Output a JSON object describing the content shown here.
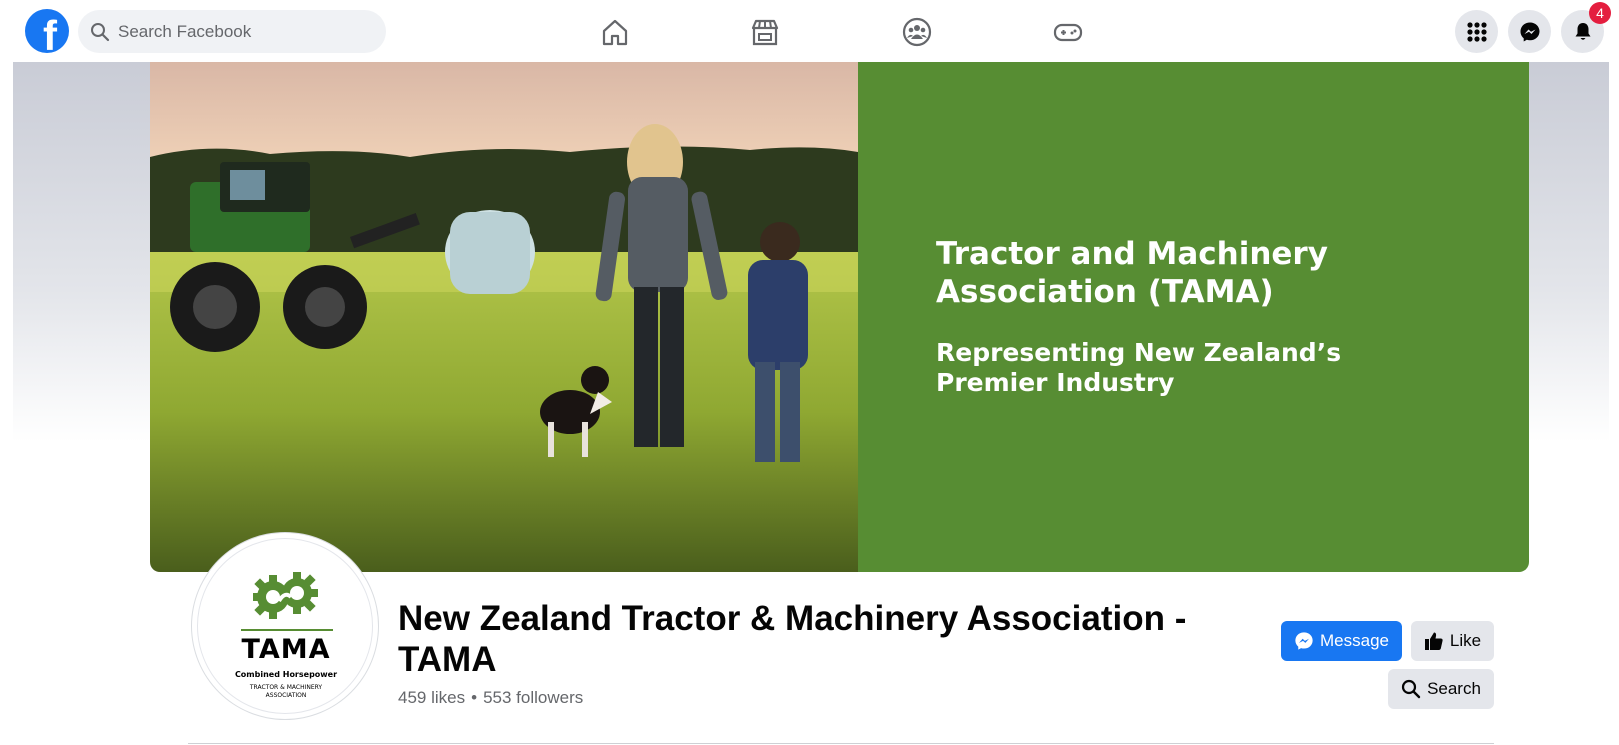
{
  "nav": {
    "logo_letter": "f",
    "search_placeholder": "Search Facebook",
    "icons": [
      "home-icon",
      "marketplace-icon",
      "groups-icon",
      "gaming-icon"
    ],
    "right_icons": [
      "menu-grid-icon",
      "messenger-icon",
      "notifications-icon"
    ],
    "notification_count": "4"
  },
  "cover": {
    "title": "Tractor and Machinery Association (TAMA)",
    "subtitle": "Representing New Zealand’s Premier Industry",
    "panel_color": "#578d33"
  },
  "profile_logo": {
    "name": "TAMA",
    "tagline": "Combined Horsepower",
    "small_line1": "TRACTOR & MACHINERY",
    "small_line2": "ASSOCIATION"
  },
  "page": {
    "title": "New Zealand Tractor & Machinery Association - TAMA",
    "likes": "459 likes",
    "followers": "553 followers",
    "separator": "•"
  },
  "actions": {
    "message_label": "Message",
    "like_label": "Like",
    "search_label": "Search"
  },
  "colors": {
    "brand": "#1877f2",
    "badge": "#e41e3f",
    "secondary_btn": "#e4e6eb"
  }
}
